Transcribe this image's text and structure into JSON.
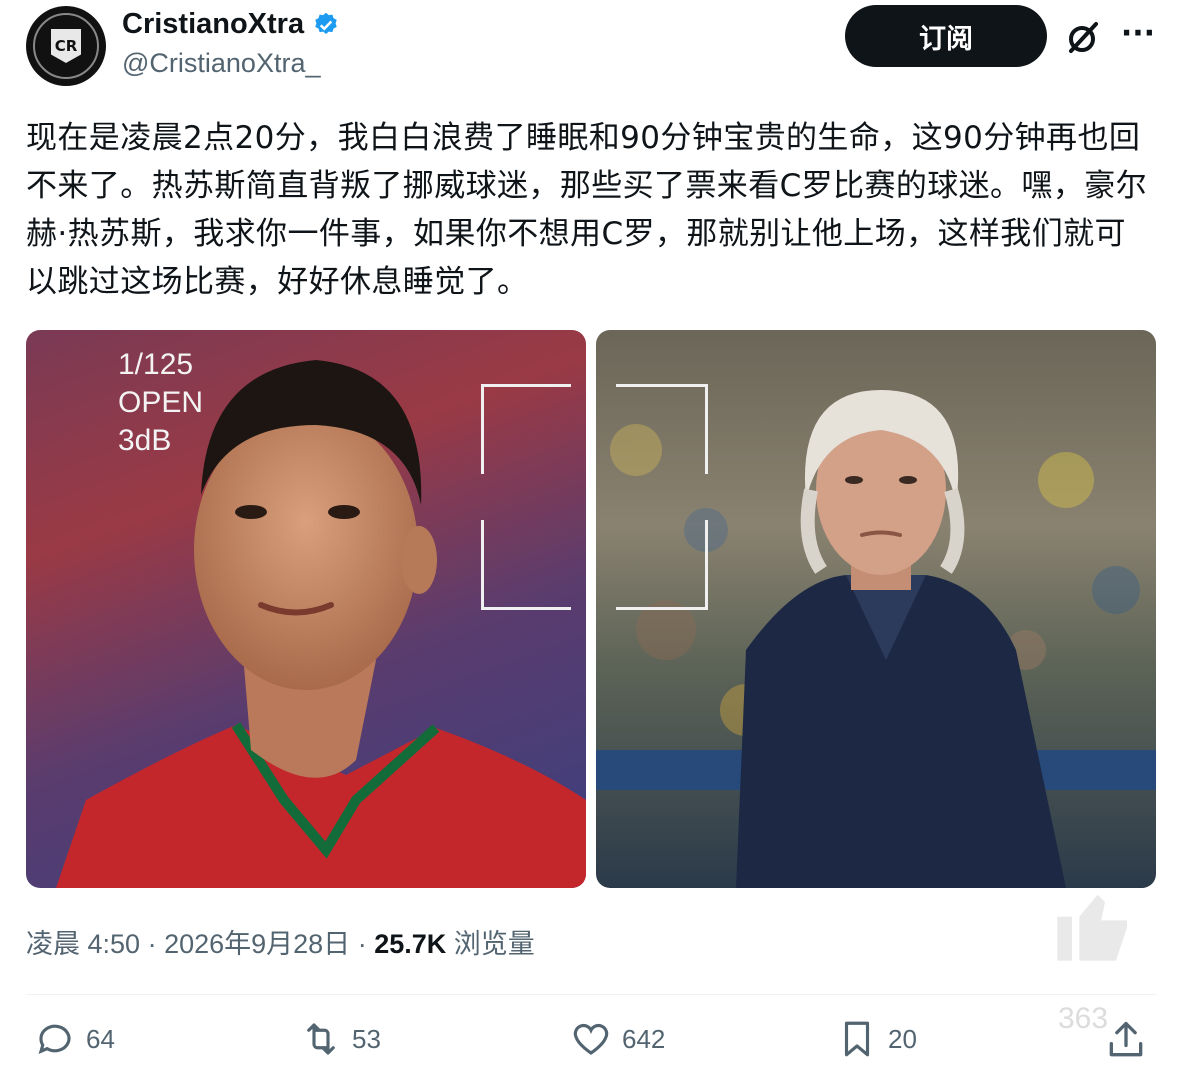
{
  "author": {
    "display_name": "CristianoXtra",
    "handle": "@CristianoXtra_",
    "avatar_monogram": "CR",
    "verified_icon": "verified-badge-icon",
    "verified_color": "#1d9bf0"
  },
  "header": {
    "subscribe_label": "订阅",
    "grok_icon": "grok-icon",
    "more_icon": "more-icon"
  },
  "tweet": {
    "text": "现在是凌晨2点20分，我白白浪费了睡眠和90分钟宝贵的生命，这90分钟再也回不来了。热苏斯简直背叛了挪威球迷，那些买了票来看C罗比赛的球迷。嘿，豪尔赫·热苏斯，我求你一件事，如果你不想用C罗，那就别让他上场，这样我们就可以跳过这场比赛，好好休息睡觉了。"
  },
  "media": {
    "left_overlay": [
      "1/125",
      "OPEN",
      "3dB"
    ]
  },
  "meta": {
    "time": "凌晨 4:50",
    "sep1": " · ",
    "date": "2026年9月28日",
    "sep2": " · ",
    "views": "25.7K",
    "views_label": " 浏览量"
  },
  "actions": {
    "replies": "64",
    "retweets": "53",
    "likes": "642",
    "bookmarks": "20"
  },
  "watermark": "363"
}
